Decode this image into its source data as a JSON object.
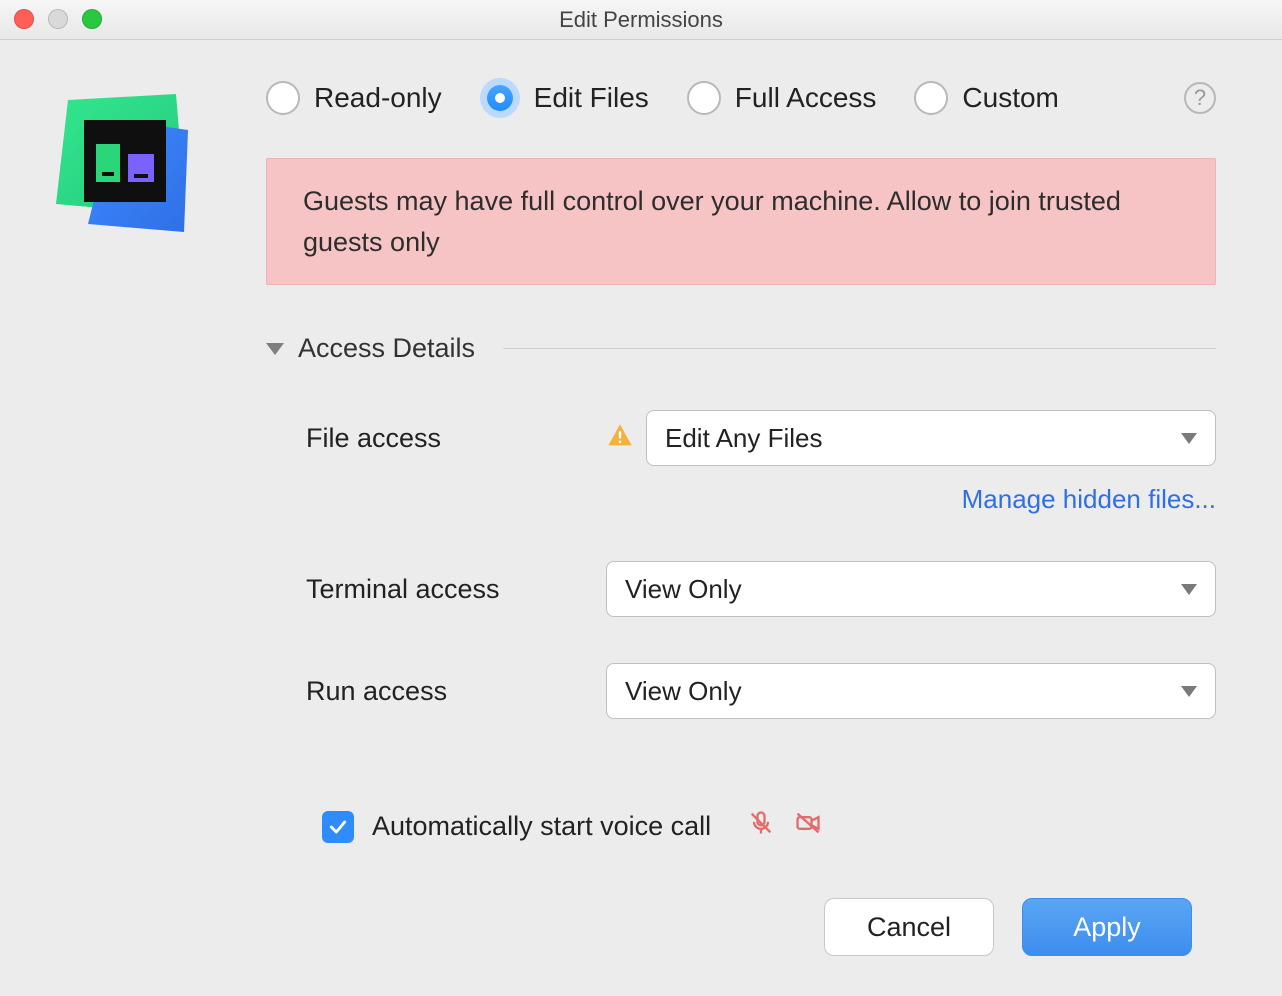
{
  "window": {
    "title": "Edit Permissions"
  },
  "radio": {
    "items": [
      {
        "label": "Read-only",
        "selected": false
      },
      {
        "label": "Edit Files",
        "selected": true
      },
      {
        "label": "Full Access",
        "selected": false
      },
      {
        "label": "Custom",
        "selected": false
      }
    ]
  },
  "warning": "Guests may have full control over your machine. Allow to join trusted guests only",
  "section": {
    "title": "Access Details"
  },
  "fields": {
    "file_access": {
      "label": "File access",
      "value": "Edit Any Files",
      "warn": true
    },
    "manage_link": "Manage hidden files...",
    "terminal_access": {
      "label": "Terminal access",
      "value": "View Only"
    },
    "run_access": {
      "label": "Run access",
      "value": "View Only"
    }
  },
  "checkbox": {
    "label": "Automatically start voice call",
    "checked": true
  },
  "buttons": {
    "cancel": "Cancel",
    "apply": "Apply"
  }
}
